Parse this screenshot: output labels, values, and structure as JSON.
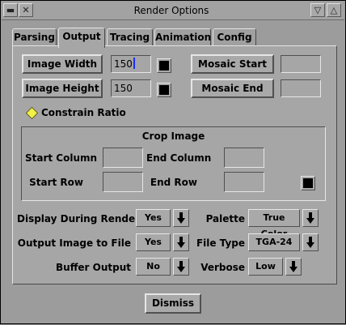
{
  "window": {
    "title": "Render Options"
  },
  "tabs": [
    "Parsing",
    "Output",
    "Tracing",
    "Animation",
    "Config"
  ],
  "image": {
    "width_label": "Image Width",
    "width_value": "150",
    "height_label": "Image Height",
    "height_value": "150"
  },
  "mosaic": {
    "start_label": "Mosaic Start",
    "start_value": "",
    "end_label": "Mosaic End",
    "end_value": ""
  },
  "constrain_label": "Constrain Ratio",
  "crop": {
    "title": "Crop Image",
    "start_column_label": "Start Column",
    "start_column_value": "",
    "end_column_label": "End Column",
    "end_column_value": "",
    "start_row_label": "Start Row",
    "start_row_value": "",
    "end_row_label": "End Row",
    "end_row_value": ""
  },
  "options": {
    "display_during_render": {
      "label": "Display During Render",
      "value": "Yes"
    },
    "output_image_to_file": {
      "label": "Output Image to File",
      "value": "Yes"
    },
    "buffer_output": {
      "label": "Buffer Output",
      "value": "No"
    },
    "palette": {
      "label": "Palette",
      "value": "True Color"
    },
    "file_type": {
      "label": "File Type",
      "value": "TGA-24"
    },
    "verbose": {
      "label": "Verbose",
      "value": "Low"
    }
  },
  "dismiss_label": "Dismiss",
  "colors": {
    "background": "#9c9c9c",
    "panel": "#a6a6a6",
    "diamond": "#f3f046",
    "cursor": "#1a2cff"
  }
}
